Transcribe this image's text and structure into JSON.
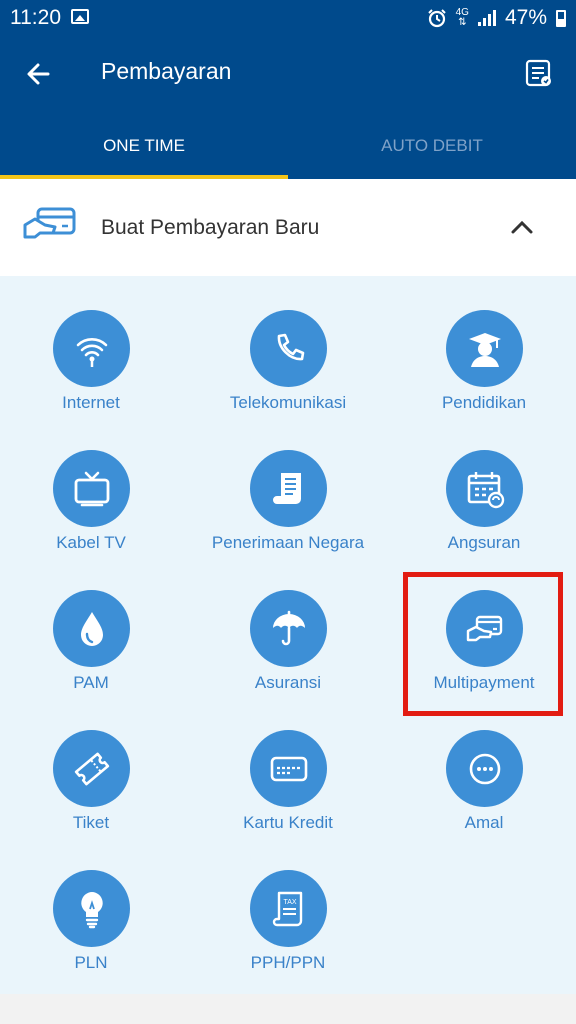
{
  "status_bar": {
    "time": "11:20",
    "network": "4G",
    "battery": "47%"
  },
  "app_bar": {
    "title": "Pembayaran",
    "back_icon": "arrow-left-icon",
    "menu_icon": "list-icon"
  },
  "tabs": [
    {
      "label": "ONE TIME",
      "active": true
    },
    {
      "label": "AUTO DEBIT",
      "active": false
    }
  ],
  "section": {
    "title": "Buat Pembayaran Baru",
    "expanded": true
  },
  "categories": [
    {
      "label": "Internet",
      "icon": "wifi-icon"
    },
    {
      "label": "Telekomunikasi",
      "icon": "phone-icon"
    },
    {
      "label": "Pendidikan",
      "icon": "graduate-icon"
    },
    {
      "label": "Kabel TV",
      "icon": "tv-icon"
    },
    {
      "label": "Penerimaan Negara",
      "icon": "document-scroll-icon"
    },
    {
      "label": "Angsuran",
      "icon": "calendar-icon"
    },
    {
      "label": "PAM",
      "icon": "water-drop-icon"
    },
    {
      "label": "Asuransi",
      "icon": "umbrella-icon"
    },
    {
      "label": "Multipayment",
      "icon": "card-hand-icon",
      "highlighted": true
    },
    {
      "label": "Tiket",
      "icon": "ticket-icon"
    },
    {
      "label": "Kartu Kredit",
      "icon": "credit-card-icon"
    },
    {
      "label": "Amal",
      "icon": "more-icon"
    },
    {
      "label": "PLN",
      "icon": "lightbulb-icon"
    },
    {
      "label": "PPH/PPN",
      "icon": "tax-document-icon"
    }
  ],
  "colors": {
    "primary": "#004a8c",
    "accent": "#f5c518",
    "icon_bg": "#3d8fd6",
    "label": "#3a82c9",
    "grid_bg": "#eaf5fb",
    "highlight": "#e21c12"
  }
}
